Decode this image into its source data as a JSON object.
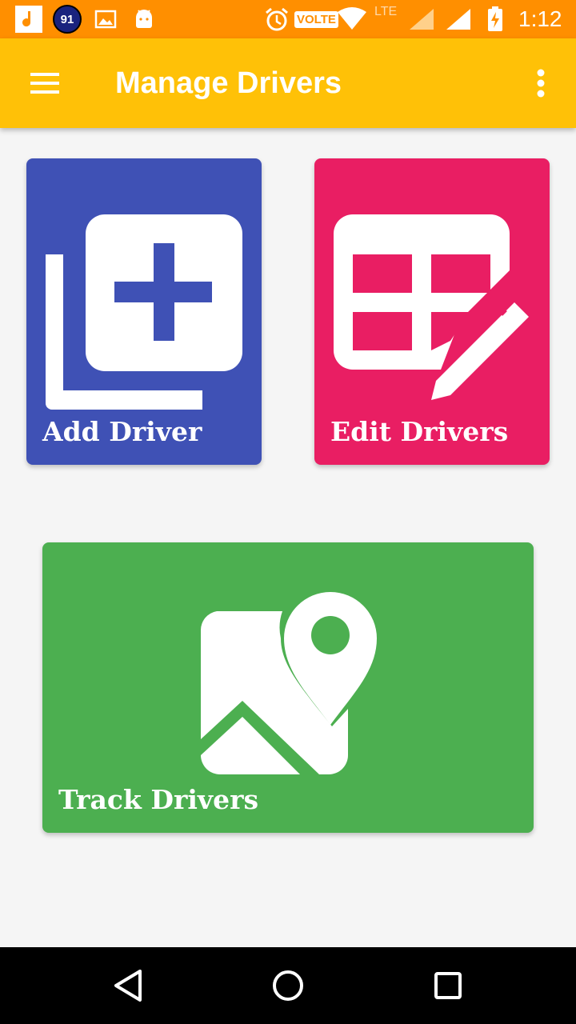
{
  "status_bar": {
    "notification_count": "91",
    "network_label": "VOLTE",
    "lte_label": "LTE",
    "time": "1:12",
    "icons": [
      "music-note-icon",
      "badge-count-icon",
      "image-icon",
      "android-icon",
      "alarm-icon",
      "volte-icon",
      "wifi-icon",
      "lte-signal-icon",
      "signal-icon",
      "battery-charging-icon"
    ]
  },
  "toolbar": {
    "title": "Manage Drivers",
    "menu_icon": "hamburger-menu-icon",
    "more_icon": "more-vert-icon",
    "background": "#ffc107"
  },
  "tiles": [
    {
      "label": "Add Driver",
      "icon": "add-to-queue-icon",
      "color": "#3f51b5"
    },
    {
      "label": "Edit Drivers",
      "icon": "table-edit-icon",
      "color": "#e91e63"
    },
    {
      "label": "Track Drivers",
      "icon": "map-pin-icon",
      "color": "#4caf50"
    }
  ],
  "nav_bar": {
    "icons": [
      "back-triangle-icon",
      "home-circle-icon",
      "recents-square-icon"
    ]
  },
  "colors": {
    "status_bar": "#ff8f00",
    "page_background": "#f5f5f5"
  }
}
